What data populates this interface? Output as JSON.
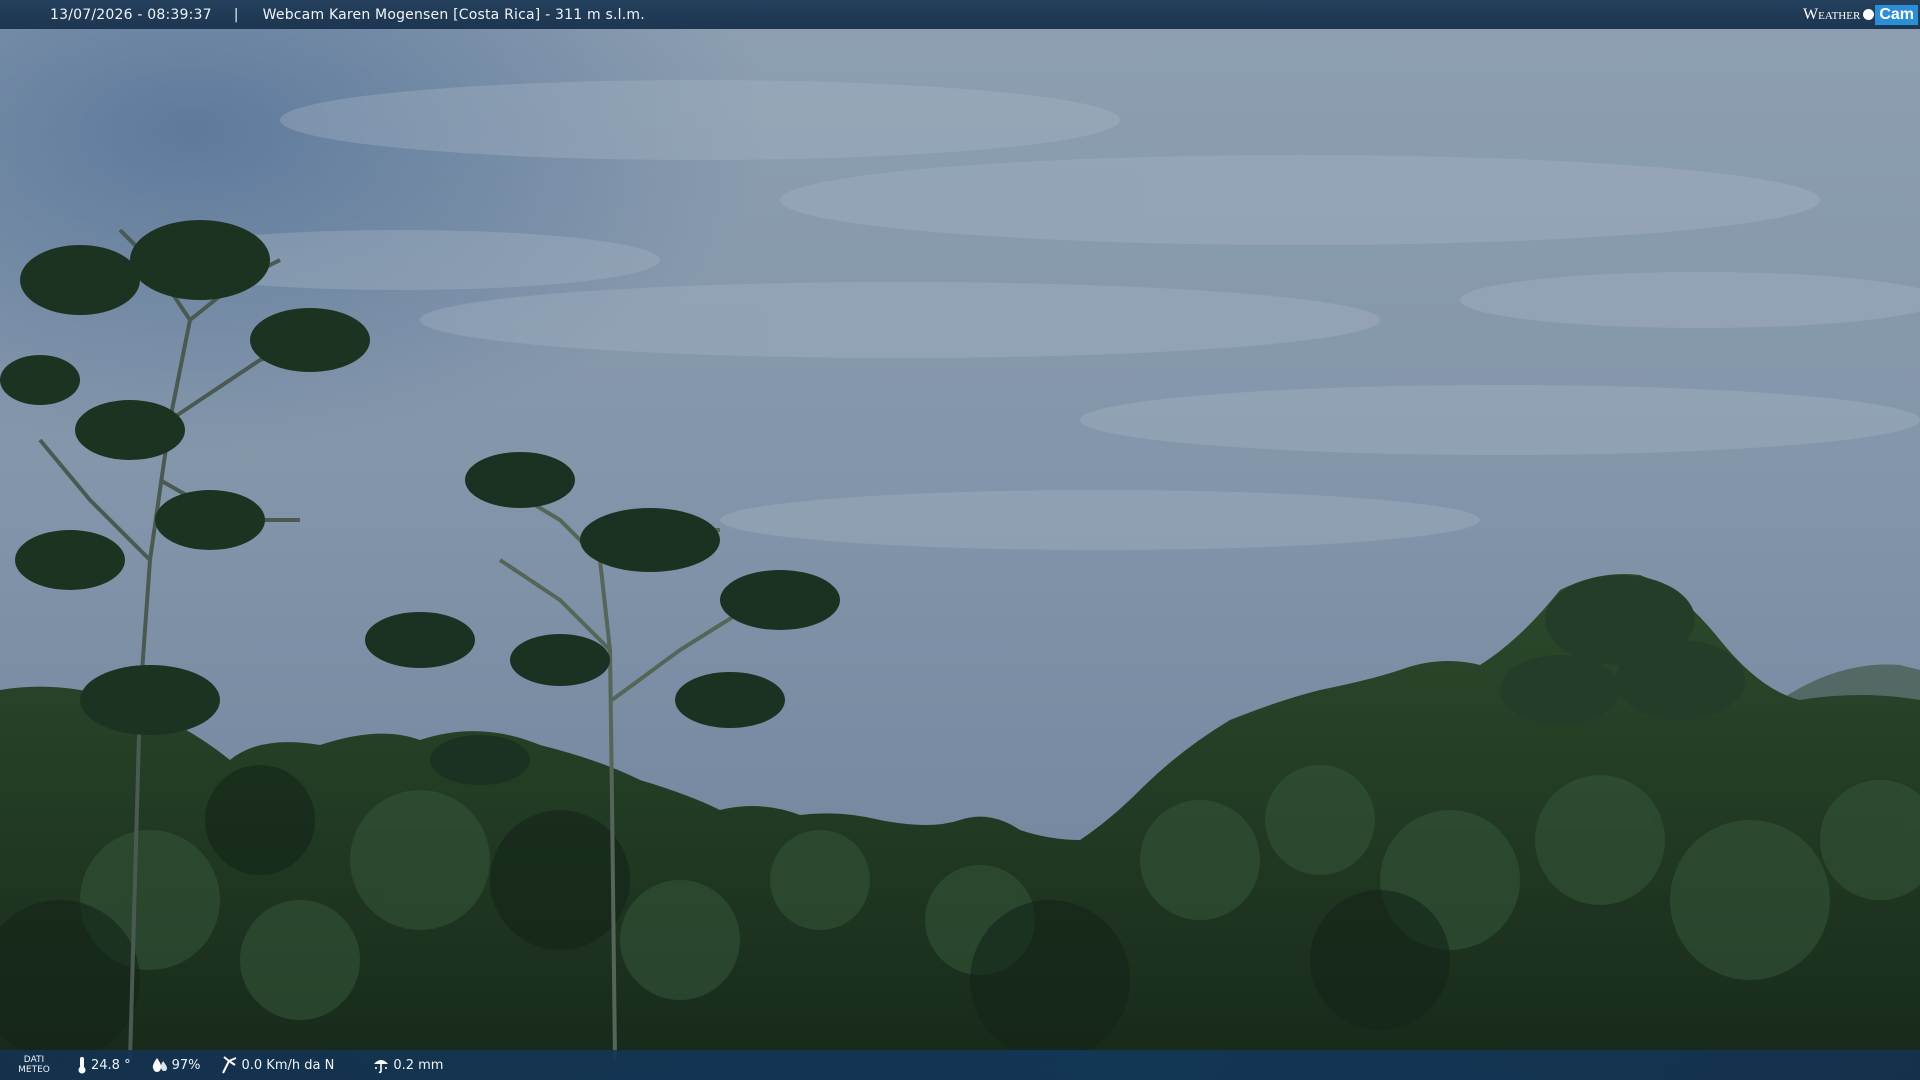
{
  "header": {
    "datetime": "13/07/2026 - 08:39:37",
    "separator": "|",
    "title": "Webcam Karen Mogensen [Costa Rica]  - 311 m s.l.m."
  },
  "logo": {
    "weather": "Weather",
    "cam": "Cam"
  },
  "footer": {
    "label_line1": "DATI",
    "label_line2": "METEO",
    "metrics": [
      {
        "icon": "thermometer-icon",
        "value": "24.8 °"
      },
      {
        "icon": "humidity-drop-icon",
        "value": "97%"
      },
      {
        "icon": "wind-icon",
        "value": "0.0 Km/h da N"
      },
      {
        "icon": "rain-icon",
        "value": "0.2 mm"
      }
    ]
  },
  "colors": {
    "bar_blue": "#1d3651",
    "logo_accent": "#2a8fd6",
    "sky": "#7f93a8",
    "foliage": "#1f3a23"
  }
}
